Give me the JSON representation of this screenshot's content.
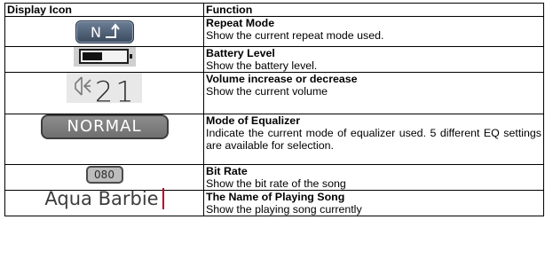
{
  "header": {
    "icon_col": "Display Icon",
    "function_col": "Function"
  },
  "rows": [
    {
      "icon": "repeat-mode-icon",
      "icon_text": "N",
      "title": "Repeat Mode",
      "desc": "Show the current repeat mode used."
    },
    {
      "icon": "battery-level-icon",
      "title": "Battery Level",
      "desc": "Show the battery level."
    },
    {
      "icon": "volume-icon",
      "icon_text": "21",
      "title": "Volume increase or decrease",
      "desc": "Show the current volume"
    },
    {
      "icon": "equalizer-mode-icon",
      "icon_text": "NORMAL",
      "title": "Mode of Equalizer",
      "desc": "Indicate the current mode of equalizer used. 5 different EQ settings are available for selection."
    },
    {
      "icon": "bit-rate-icon",
      "icon_text": "080",
      "title": "Bit Rate",
      "desc": "Show the bit rate of the song"
    },
    {
      "icon": "song-name-display",
      "icon_text": "Aqua Barbie",
      "title": "The Name of Playing Song",
      "desc": "Show the playing song currently"
    }
  ],
  "colors": {
    "repeat_icon_bg": "#4e5f75",
    "eq_pill_bg": "#7d7d7d",
    "song_cursor": "#b60020"
  }
}
